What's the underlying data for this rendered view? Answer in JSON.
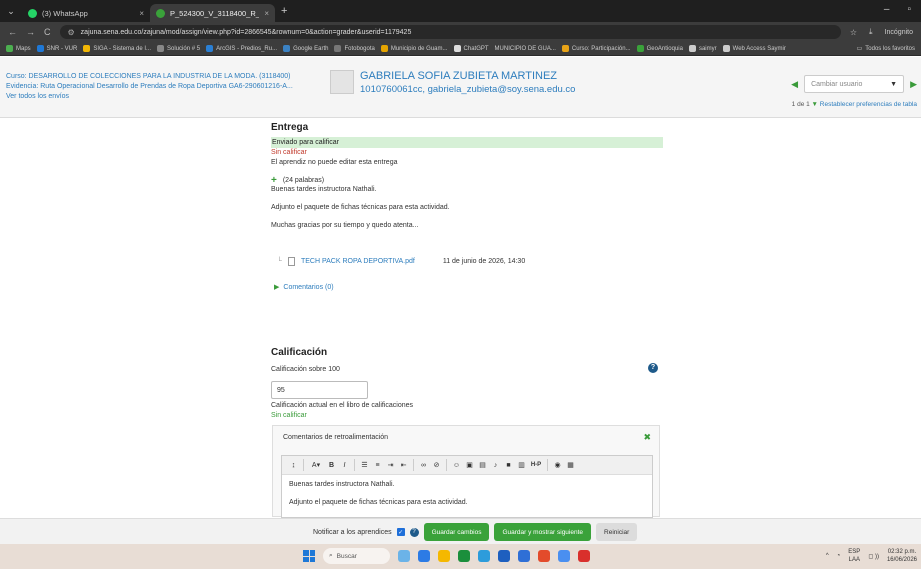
{
  "browser": {
    "tabs": [
      {
        "label": "(3) WhatsApp",
        "color": "#25d366"
      },
      {
        "label": "P_524300_V_3118400_R_44_C",
        "color": "#3aa23a"
      }
    ],
    "url": "zajuna.sena.edu.co/zajuna/mod/assign/view.php?id=2866545&rownum=0&action=grader&userid=1179425",
    "incognito": "Incógnito",
    "bookmarks": [
      "Maps",
      "SNR - VUR",
      "SIGA - Sistema de I...",
      "Solución # 5",
      "ArcGIS - Predios_Ru...",
      "Google Earth",
      "Fotobogota",
      "Municipio de Guam...",
      "ChatGPT",
      "MUNICIPIO DE GUA...",
      "Curso: Participación...",
      "GeoAntioquia",
      "saimyr",
      "Web Access Saymir"
    ],
    "bookmarks_all": "Todos los favoritos"
  },
  "header": {
    "course": "Curso: DESARROLLO DE COLECCIONES PARA LA INDUSTRIA DE LA MODA. (3118400)",
    "evidence": "Evidencia: Ruta Operacional Desarrollo de Prendas de Ropa Deportiva GA6-290601216-A...",
    "view_all": "Ver todos los envíos",
    "student_name": "GABRIELA SOFIA ZUBIETA MARTINEZ",
    "student_email": "1010760061cc, gabriela_zubieta@soy.sena.edu.co",
    "change_user": "Cambiar usuario",
    "pager": "1 de 1",
    "reset_prefs": "Restablecer preferencias de tabla"
  },
  "submission": {
    "title": "Entrega",
    "status": "Enviado para calificar",
    "grading_status": "Sin calificar",
    "edit_note": "El aprendiz no puede editar esta entrega",
    "word_count": "(24 palabras)",
    "lines": [
      "Buenas tardes instructora Nathali.",
      "Adjunto el paquete de fichas técnicas para esta actividad.",
      "Muchas gracias por su tiempo y quedo atenta..."
    ],
    "attachment": "TECH PACK ROPA DEPORTIVA.pdf",
    "attachment_date": "11 de junio de 2026, 14:30",
    "comments": "Comentarios (0)"
  },
  "grade": {
    "title": "Calificación",
    "label": "Calificación sobre 100",
    "value": "95",
    "current_label": "Calificación actual en el libro de calificaciones",
    "current_value": "Sin calificar"
  },
  "feedback": {
    "title": "Comentarios de retroalimentación",
    "line1": "Buenas tardes instructora Nathali.",
    "line2": "Adjunto el paquete de fichas técnicas para esta actividad."
  },
  "footer": {
    "notify": "Notificar a los aprendices",
    "save": "Guardar cambios",
    "save_next": "Guardar y mostrar siguiente",
    "reset": "Reiniciar"
  },
  "taskbar": {
    "search": "Buscar",
    "lang1": "ESP",
    "lang2": "LAA",
    "time": "02:32 p.m.",
    "date": "16/06/2026"
  },
  "colors": {
    "link": "#2d7dbd",
    "accent_green": "#3aa23a",
    "status_bg": "#d6f0d6",
    "error_red": "#c0392b"
  }
}
